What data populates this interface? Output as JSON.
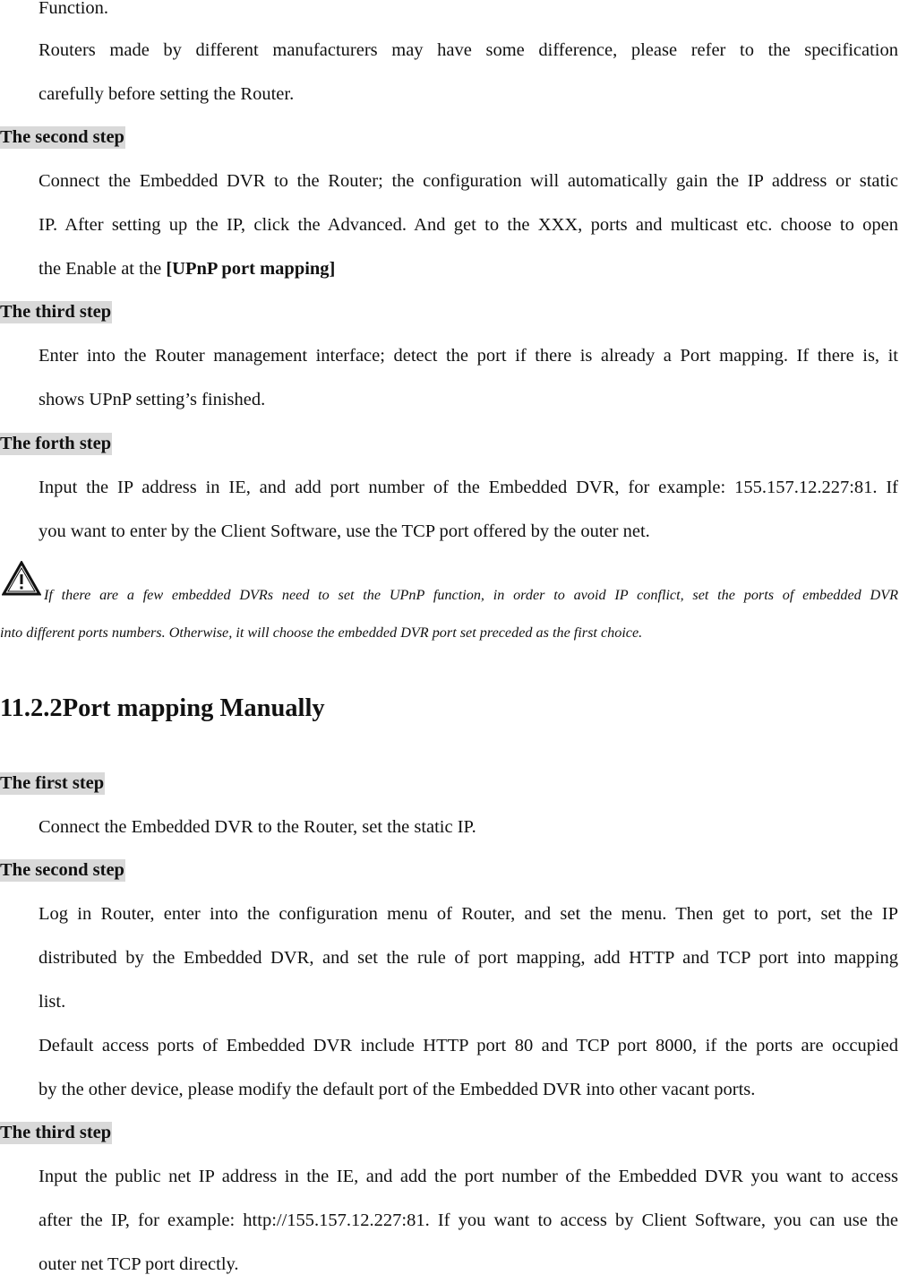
{
  "document": {
    "top_lines": {
      "function_tail": "Function.",
      "routers_line1": "Routers made by different manufacturers may have some difference, please refer to the specification",
      "routers_line2": "carefully before setting the Router."
    },
    "upnp_steps": {
      "second": {
        "label": "The second step",
        "line1": "Connect the Embedded DVR to the Router; the configuration will automatically gain the IP address or static",
        "line2": "IP. After setting up the IP, click the Advanced. And get to the XXX, ports and multicast etc. choose to open",
        "line3_prefix": "the Enable at the ",
        "line3_bold": "[UPnP port mapping]"
      },
      "third": {
        "label": "The third step",
        "line1": "Enter into the Router management interface; detect the port if there is already a Port mapping. If there is, it",
        "line2": "shows UPnP setting’s finished."
      },
      "forth": {
        "label": "The forth step",
        "line1": "Input the IP address in IE, and add port number of the Embedded DVR, for example: 155.157.12.227:81. If",
        "line2": "you want to enter by the Client Software, use the TCP port offered by the outer net."
      }
    },
    "note": {
      "icon": "warning-triangle-icon",
      "line1": "If there are a few embedded DVRs need to set the UPnP function, in order to avoid IP conflict, set the ports of embedded DVR",
      "line2": "into different ports numbers. Otherwise, it will choose the embedded DVR port set preceded as the first choice."
    },
    "section": {
      "number": "11.2.2",
      "title": "Port mapping Manually"
    },
    "manual_steps": {
      "first": {
        "label": "The first step",
        "line1": "Connect the Embedded DVR to the Router, set the static IP."
      },
      "second": {
        "label": "The second step",
        "line1": "Log in Router, enter into the configuration menu of Router, and set the menu. Then get to port, set the IP",
        "line2": "distributed by the Embedded DVR, and set the rule of port mapping, add HTTP and TCP port into mapping",
        "line3": "list.",
        "line4": "Default access ports of Embedded DVR include HTTP port 80 and TCP port 8000, if the ports are occupied",
        "line5": "by the other device, please modify the default port of the Embedded DVR into other vacant ports."
      },
      "third": {
        "label": "The third step",
        "line1": "Input the public net IP address in the IE, and add the port number of the Embedded DVR you want to access",
        "line2": "after the IP, for example: http://155.157.12.227:81. If you want to access by Client Software, you can use the",
        "line3": "outer net TCP port directly."
      }
    }
  }
}
